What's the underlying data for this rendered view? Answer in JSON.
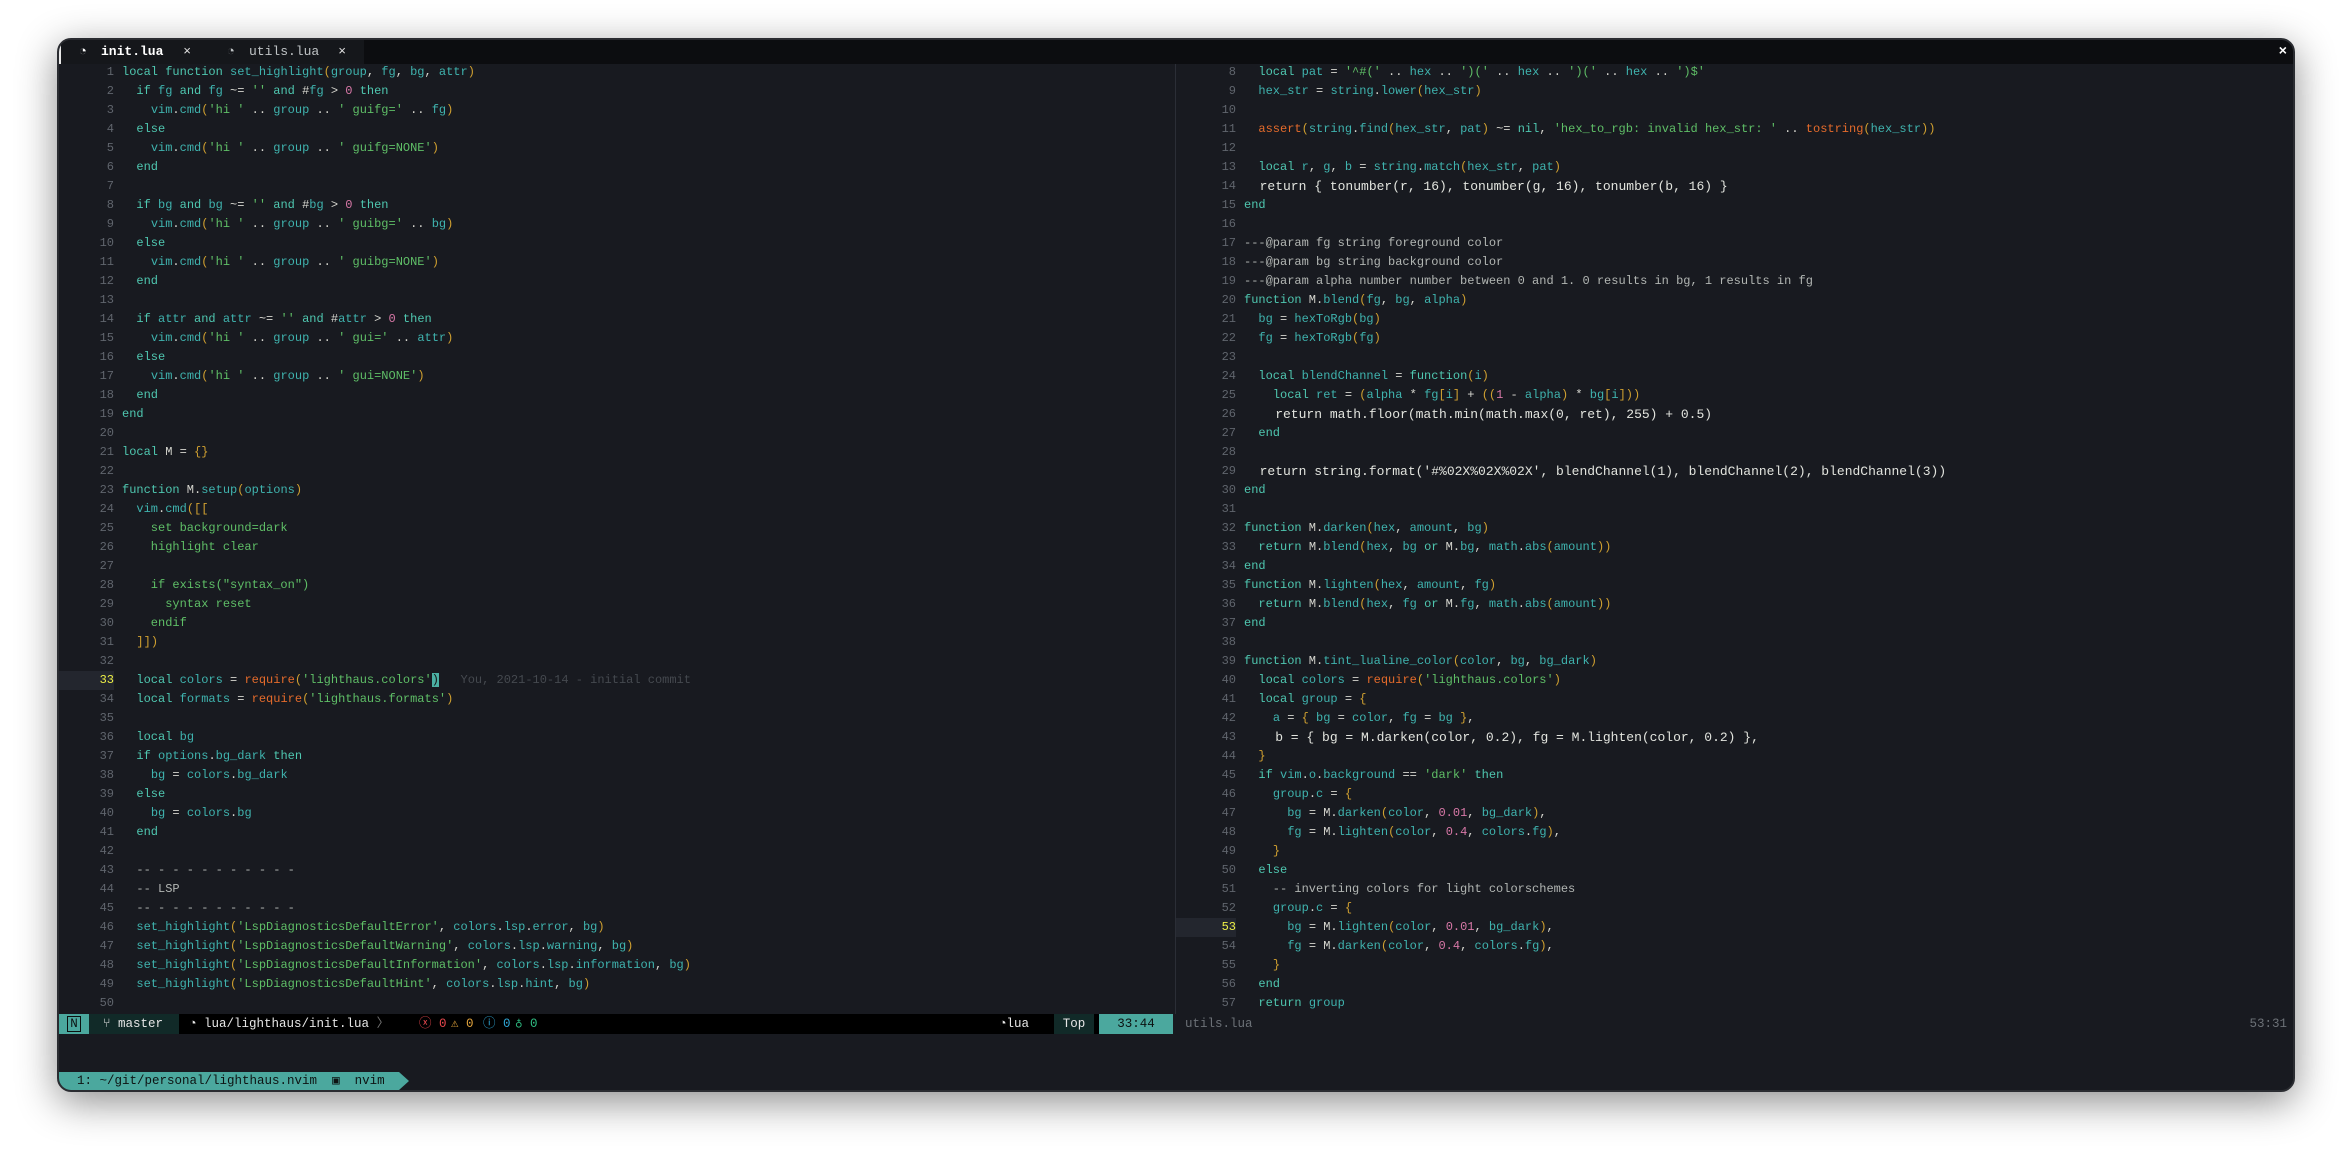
{
  "tabs": [
    {
      "label": "init.lua",
      "icon": "lua-icon",
      "active": true
    },
    {
      "label": "utils.lua",
      "icon": "lua-icon",
      "active": false
    }
  ],
  "close_all": "×",
  "tab_close": "×",
  "left_pane": {
    "start": 1,
    "cursor_line": 33,
    "blame": "You, 2021-10-14 - initial commit",
    "lines": [
      "local function set_highlight(group, fg, bg, attr)",
      "  if fg and fg ~= '' and #fg > 0 then",
      "    vim.cmd('hi ' .. group .. ' guifg=' .. fg)",
      "  else",
      "    vim.cmd('hi ' .. group .. ' guifg=NONE')",
      "  end",
      "",
      "  if bg and bg ~= '' and #bg > 0 then",
      "    vim.cmd('hi ' .. group .. ' guibg=' .. bg)",
      "  else",
      "    vim.cmd('hi ' .. group .. ' guibg=NONE')",
      "  end",
      "",
      "  if attr and attr ~= '' and #attr > 0 then",
      "    vim.cmd('hi ' .. group .. ' gui=' .. attr)",
      "  else",
      "    vim.cmd('hi ' .. group .. ' gui=NONE')",
      "  end",
      "end",
      "",
      "local M = {}",
      "",
      "function M.setup(options)",
      "  vim.cmd([[",
      "    set background=dark",
      "    highlight clear",
      "",
      "    if exists(\"syntax_on\")",
      "      syntax reset",
      "    endif",
      "  ]])",
      "",
      "  local colors = require('lighthaus.colors')",
      "  local formats = require('lighthaus.formats')",
      "",
      "  local bg",
      "  if options.bg_dark then",
      "    bg = colors.bg_dark",
      "  else",
      "    bg = colors.bg",
      "  end",
      "",
      "  -- - - - - - - - - - -",
      "  -- LSP",
      "  -- - - - - - - - - - -",
      "  set_highlight('LspDiagnosticsDefaultError', colors.lsp.error, bg)",
      "  set_highlight('LspDiagnosticsDefaultWarning', colors.lsp.warning, bg)",
      "  set_highlight('LspDiagnosticsDefaultInformation', colors.lsp.information, bg)",
      "  set_highlight('LspDiagnosticsDefaultHint', colors.lsp.hint, bg)",
      ""
    ]
  },
  "right_pane": {
    "start": 8,
    "cursor_line": 53,
    "lines": [
      "  local pat = '^#(' .. hex .. ')(' .. hex .. ')(' .. hex .. ')$'",
      "  hex_str = string.lower(hex_str)",
      "",
      "  assert(string.find(hex_str, pat) ~= nil, 'hex_to_rgb: invalid hex_str: ' .. tostring(hex_str))",
      "",
      "  local r, g, b = string.match(hex_str, pat)",
      "  return { tonumber(r, 16), tonumber(g, 16), tonumber(b, 16) }",
      "end",
      "",
      "---@param fg string foreground color",
      "---@param bg string background color",
      "---@param alpha number number between 0 and 1. 0 results in bg, 1 results in fg",
      "function M.blend(fg, bg, alpha)",
      "  bg = hexToRgb(bg)",
      "  fg = hexToRgb(fg)",
      "",
      "  local blendChannel = function(i)",
      "    local ret = (alpha * fg[i] + ((1 - alpha) * bg[i]))",
      "    return math.floor(math.min(math.max(0, ret), 255) + 0.5)",
      "  end",
      "",
      "  return string.format('#%02X%02X%02X', blendChannel(1), blendChannel(2), blendChannel(3))",
      "end",
      "",
      "function M.darken(hex, amount, bg)",
      "  return M.blend(hex, bg or M.bg, math.abs(amount))",
      "end",
      "function M.lighten(hex, amount, fg)",
      "  return M.blend(hex, fg or M.fg, math.abs(amount))",
      "end",
      "",
      "function M.tint_lualine_color(color, bg, bg_dark)",
      "  local colors = require('lighthaus.colors')",
      "  local group = {",
      "    a = { bg = color, fg = bg },",
      "    b = { bg = M.darken(color, 0.2), fg = M.lighten(color, 0.2) },",
      "  }",
      "  if vim.o.background == 'dark' then",
      "    group.c = {",
      "      bg = M.darken(color, 0.01, bg_dark),",
      "      fg = M.lighten(color, 0.4, colors.fg),",
      "    }",
      "  else",
      "    -- inverting colors for light colorschemes",
      "    group.c = {",
      "      bg = M.lighten(color, 0.01, bg_dark),",
      "      fg = M.darken(color, 0.4, colors.fg),",
      "    }",
      "  end",
      "  return group"
    ]
  },
  "statusline": {
    "mode": "N",
    "branch": "master",
    "file": "lua/lighthaus/init.lua",
    "diagnostics": {
      "errors": "0",
      "warnings": "0",
      "info": "0",
      "hints": "0"
    },
    "filetype": "lua",
    "position": "Top",
    "cursor": "33:44",
    "inactive_file": "utils.lua",
    "inactive_cursor": "53:31"
  },
  "tmux": {
    "window": "1: ~/git/personal/lighthaus.nvim",
    "process": "nvim"
  },
  "colors": {
    "accent": "#4ba89e",
    "background": "#181a20",
    "keyword": "#4fc7b0",
    "string": "#5fbf67",
    "number": "#d878a7",
    "function": "#e56b2b",
    "error": "#e8474d",
    "warning": "#e3a43c",
    "info": "#2fa8d8",
    "hint": "#2fbf84"
  }
}
